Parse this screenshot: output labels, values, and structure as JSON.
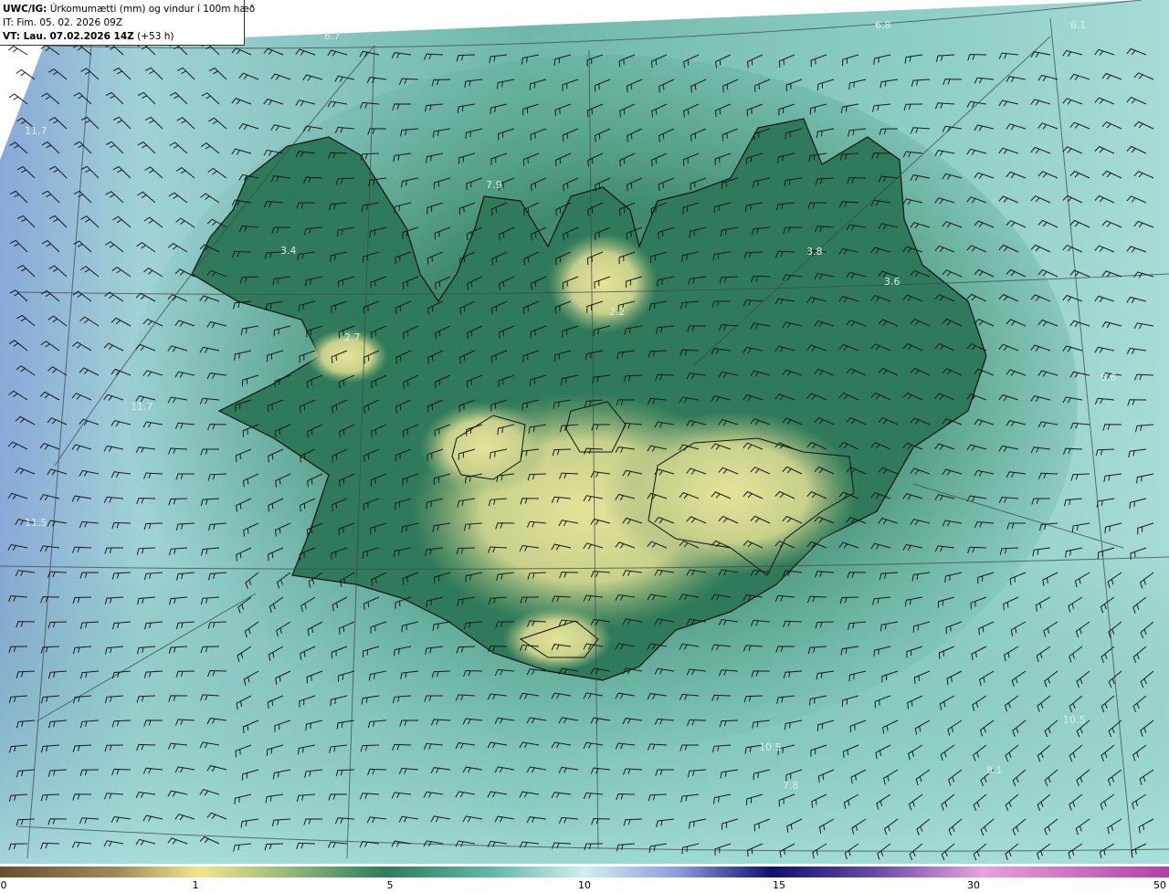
{
  "header": {
    "line1_prefix": "UWC/IG:",
    "line1_title": "Úrkomumætti (mm) og vindur í 100m hæð",
    "line2": "IT: Fim. 05. 02. 2026 09Z",
    "line3_prefix": "VT: Lau. 07.02.2026 14Z",
    "line3_suffix": "(+53 h)"
  },
  "colorbar": {
    "ticks": [
      {
        "label": "0",
        "value": 0
      },
      {
        "label": "1",
        "value": 1
      },
      {
        "label": "5",
        "value": 5
      },
      {
        "label": "10",
        "value": 10
      },
      {
        "label": "15",
        "value": 15
      },
      {
        "label": "30",
        "value": 30
      },
      {
        "label": "50",
        "value": 50
      }
    ],
    "colors": [
      "#6b4e2e",
      "#c9b884",
      "#f0e68c",
      "#2e7d5b",
      "#5fb8a8",
      "#cfeff0",
      "#6f7fd0",
      "#101070",
      "#8a5ac0",
      "#e8a0e0",
      "#c04fb0"
    ]
  },
  "map": {
    "value_labels": [
      {
        "text": "6.7"
      },
      {
        "text": "6.8"
      },
      {
        "text": "6.1"
      },
      {
        "text": "11.7"
      },
      {
        "text": "3.4"
      },
      {
        "text": "7.9"
      },
      {
        "text": "3.8"
      },
      {
        "text": "3.6"
      },
      {
        "text": "2.2"
      },
      {
        "text": "2.7"
      },
      {
        "text": "11.7"
      },
      {
        "text": "6.6"
      },
      {
        "text": "11.5"
      },
      {
        "text": "10.5"
      },
      {
        "text": "10.5"
      },
      {
        "text": "8.1"
      },
      {
        "text": "7.8"
      }
    ],
    "colors": {
      "ocean_high": "#8fd4cf",
      "ocean_mid": "#5fae9a",
      "land_low": "#2f7a5c",
      "land_dry": "#d8d98a",
      "west_blue": "#8aa8d8",
      "coast_line": "#111111",
      "grid_line": "#3c4a4a"
    }
  }
}
